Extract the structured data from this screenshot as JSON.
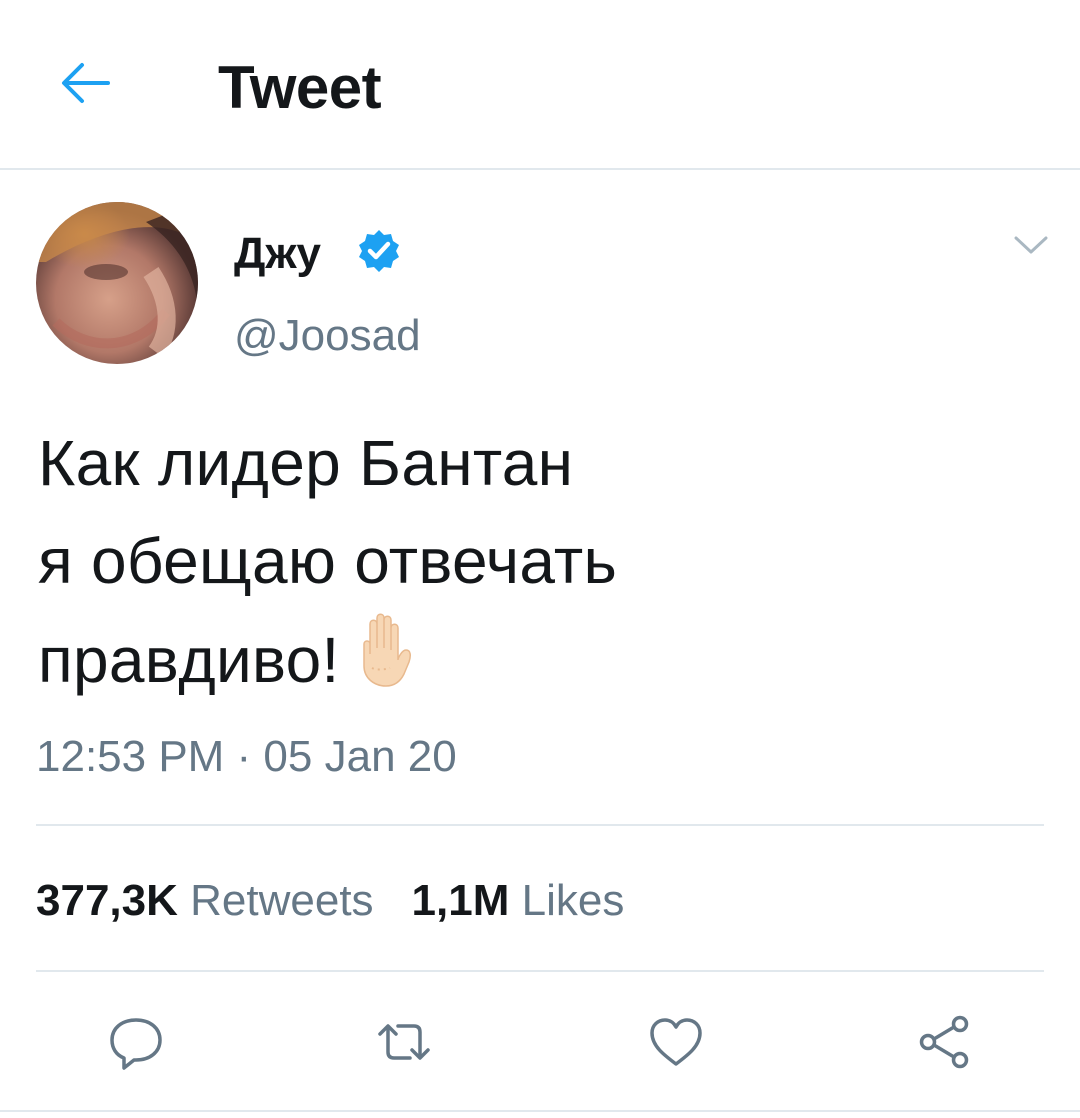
{
  "header": {
    "title": "Tweet"
  },
  "tweet": {
    "author": {
      "name": "Джу",
      "handle": "@Joosad",
      "verified": true
    },
    "text_lines": [
      "Как лидер Бантан",
      "я обещаю отвечать",
      "правдиво!"
    ],
    "emoji": "raised-hand",
    "timestamp": "12:53 PM · 05 Jan 20",
    "retweets": {
      "count": "377,3K",
      "label": "Retweets"
    },
    "likes": {
      "count": "1,1M",
      "label": "Likes"
    }
  },
  "icons": {
    "back": "arrow-left-icon",
    "caret": "chevron-down-icon",
    "reply": "reply-icon",
    "retweet": "retweet-icon",
    "like": "heart-icon",
    "share": "share-icon"
  },
  "colors": {
    "accent": "#1da1f2",
    "text": "#14171a",
    "muted": "#657786",
    "divider": "#e1e8ed"
  }
}
